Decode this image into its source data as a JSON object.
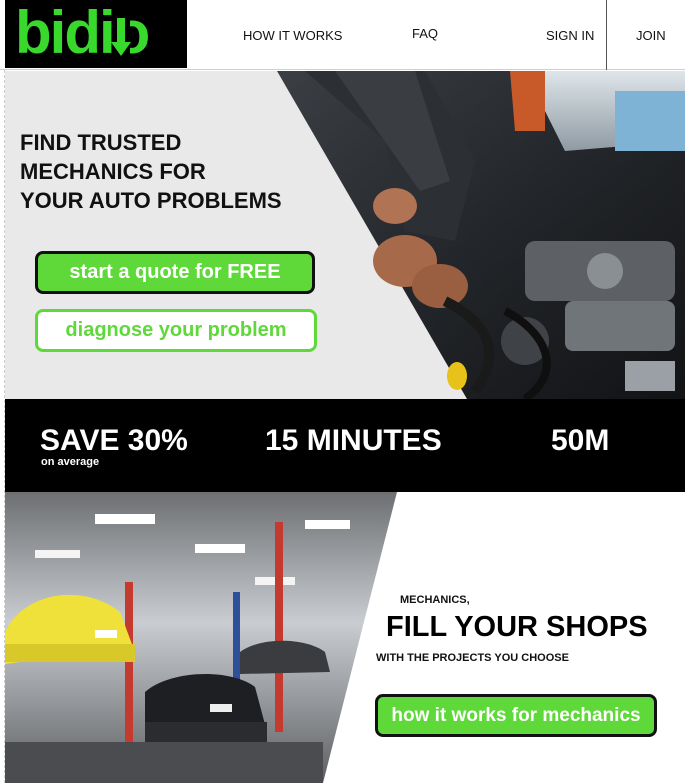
{
  "header": {
    "logo_text": "bidio",
    "nav": {
      "how_it_works": "HOW IT WORKS",
      "faq": "FAQ",
      "sign_in": "SIGN IN",
      "join": "JOIN"
    }
  },
  "hero": {
    "title_line1": "FIND TRUSTED",
    "title_line2": "MECHANICS FOR",
    "title_line3": "YOUR AUTO PROBLEMS",
    "primary_button": "start a quote for FREE",
    "secondary_button": "diagnose your problem"
  },
  "stats": {
    "save": "SAVE 30%",
    "save_caption": "on average",
    "minutes": "15 MINUTES",
    "count": "50M"
  },
  "mechanics": {
    "kicker": "MECHANICS,",
    "headline": "FILL YOUR SHOPS",
    "subline": "WITH THE PROJECTS YOU CHOOSE",
    "button": "how it works for mechanics"
  },
  "colors": {
    "brand_green": "#5fd93a",
    "logo_green": "#38d82c",
    "dark": "#000000"
  }
}
